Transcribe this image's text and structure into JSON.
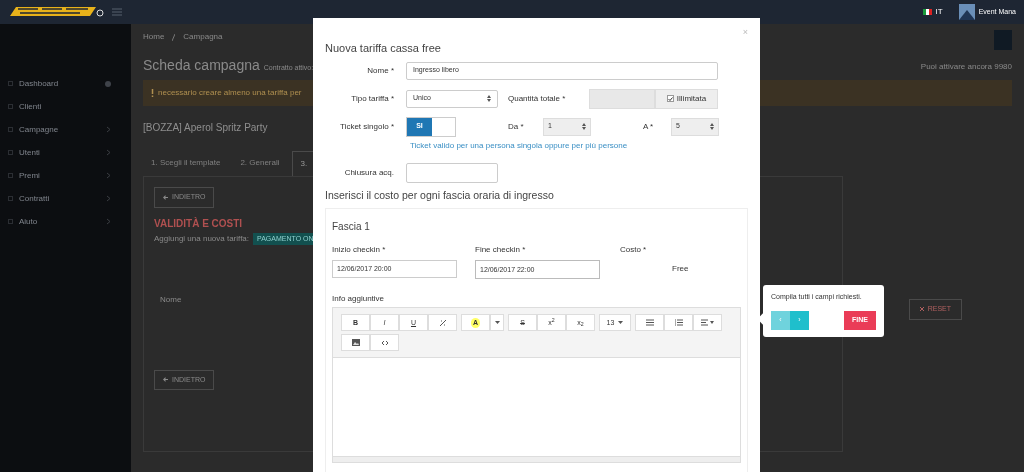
{
  "topbar": {
    "language": "IT",
    "user": "Event Mana"
  },
  "sidebar": {
    "items": [
      {
        "label": "Dashboard",
        "kind": "badge"
      },
      {
        "label": "Clienti",
        "kind": "plain"
      },
      {
        "label": "Campagne",
        "kind": "chevron"
      },
      {
        "label": "Utenti",
        "kind": "chevron"
      },
      {
        "label": "Premi",
        "kind": "chevron"
      },
      {
        "label": "Contratti",
        "kind": "chevron"
      },
      {
        "label": "Aiuto",
        "kind": "chevron"
      }
    ]
  },
  "breadcrumb": [
    "Home",
    "Campagna"
  ],
  "page": {
    "title": "Scheda campagna",
    "subtitle": "Contratto attivo:",
    "remaining": "Puoi attivare ancora 9980",
    "alert": "necessario creare almeno una tariffa per",
    "campaign": "[BOZZA] Aperol Spritz Party",
    "tabs": [
      {
        "label": "1. Scegli il template",
        "selected": false
      },
      {
        "label": "2. Generali",
        "selected": false
      },
      {
        "label": "3.",
        "selected": true
      }
    ],
    "back": "INDIETRO",
    "section": "VALIDITÀ E COSTI",
    "add_label": "Aggiungi una nuova tariffa:",
    "add_badge": "PAGAMENTO ON",
    "table_header": "Nome",
    "reset": "RESET",
    "back_bottom": "INDIETRO"
  },
  "modal": {
    "title": "Nuova tariffa cassa free",
    "close": "×",
    "name": {
      "label": "Nome *",
      "value": "Ingresso libero"
    },
    "type": {
      "label": "Tipo tariffa *",
      "value": "Unico"
    },
    "quantity": {
      "label": "Quantità totale *",
      "unlimited": {
        "label": "Illimitata",
        "checked": true
      }
    },
    "single": {
      "label": "Ticket singolo *",
      "option": "SI",
      "on": true,
      "help": "Ticket valido per una persona singola oppure per più persone"
    },
    "from": {
      "label": "Da *",
      "value": "1"
    },
    "to": {
      "label": "A *",
      "value": "5"
    },
    "closing": {
      "label": "Chiusura acq."
    },
    "section": "Inserisci il costo per ogni fascia oraria di ingresso",
    "band": {
      "title": "Fascia 1",
      "start": {
        "label": "Inizio checkin *",
        "value": "12/06/2017 20:00"
      },
      "end": {
        "label": "Fine checkin *",
        "value": "12/06/2017 22:00"
      },
      "cost": {
        "label": "Costo *",
        "value": "Free"
      },
      "info": "Info aggiuntive",
      "toolbar": [
        [
          {
            "kind": "bold",
            "label": "B"
          },
          {
            "kind": "italic",
            "label": "I"
          },
          {
            "kind": "underline",
            "label": "U"
          },
          {
            "kind": "link"
          }
        ],
        [
          {
            "kind": "highlight",
            "label": "A"
          },
          {
            "kind": "caret"
          }
        ],
        [
          {
            "kind": "strike",
            "label": "S"
          },
          {
            "kind": "plain",
            "label": "x$^{2}$"
          },
          {
            "kind": "plain",
            "label": "x$_{2}$"
          }
        ],
        [
          {
            "kind": "dropdown",
            "label": "13"
          }
        ],
        [
          {
            "kind": "list-ul"
          },
          {
            "kind": "list-ol"
          },
          {
            "kind": "align"
          }
        ],
        [
          {
            "kind": "image"
          },
          {
            "kind": "code"
          }
        ]
      ]
    }
  },
  "tour": {
    "text": "Compila tutti i campi richiesti.",
    "prev": "‹",
    "next": "›",
    "done": "FINE"
  }
}
